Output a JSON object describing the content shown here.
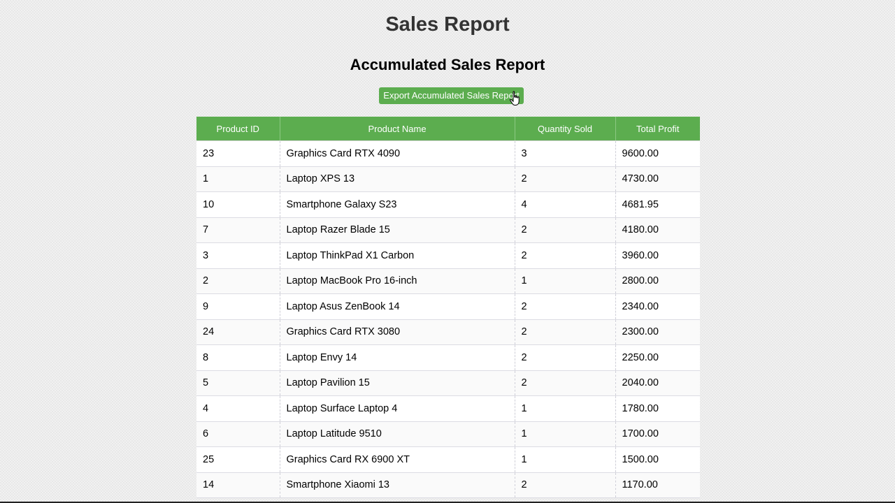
{
  "page": {
    "title": "Sales Report",
    "section_title": "Accumulated Sales Report",
    "export_button_label": "Export Accumulated Sales Report"
  },
  "table": {
    "headers": [
      "Product ID",
      "Product Name",
      "Quantity Sold",
      "Total Profit"
    ],
    "rows": [
      [
        "23",
        "Graphics Card RTX 4090",
        "3",
        "9600.00"
      ],
      [
        "1",
        "Laptop XPS 13",
        "2",
        "4730.00"
      ],
      [
        "10",
        "Smartphone Galaxy S23",
        "4",
        "4681.95"
      ],
      [
        "7",
        "Laptop Razer Blade 15",
        "2",
        "4180.00"
      ],
      [
        "3",
        "Laptop ThinkPad X1 Carbon",
        "2",
        "3960.00"
      ],
      [
        "2",
        "Laptop MacBook Pro 16-inch",
        "1",
        "2800.00"
      ],
      [
        "9",
        "Laptop Asus ZenBook 14",
        "2",
        "2340.00"
      ],
      [
        "24",
        "Graphics Card RTX 3080",
        "2",
        "2300.00"
      ],
      [
        "8",
        "Laptop Envy 14",
        "2",
        "2250.00"
      ],
      [
        "5",
        "Laptop Pavilion 15",
        "2",
        "2040.00"
      ],
      [
        "4",
        "Laptop Surface Laptop 4",
        "1",
        "1780.00"
      ],
      [
        "6",
        "Laptop Latitude 9510",
        "1",
        "1700.00"
      ],
      [
        "25",
        "Graphics Card RX 6900 XT",
        "1",
        "1500.00"
      ],
      [
        "14",
        "Smartphone Xiaomi 13",
        "2",
        "1170.00"
      ]
    ]
  },
  "colors": {
    "accent_green": "#5cad4f",
    "title_text": "#333333"
  },
  "icons": {
    "cursor": "hand-pointer-cursor-icon"
  }
}
